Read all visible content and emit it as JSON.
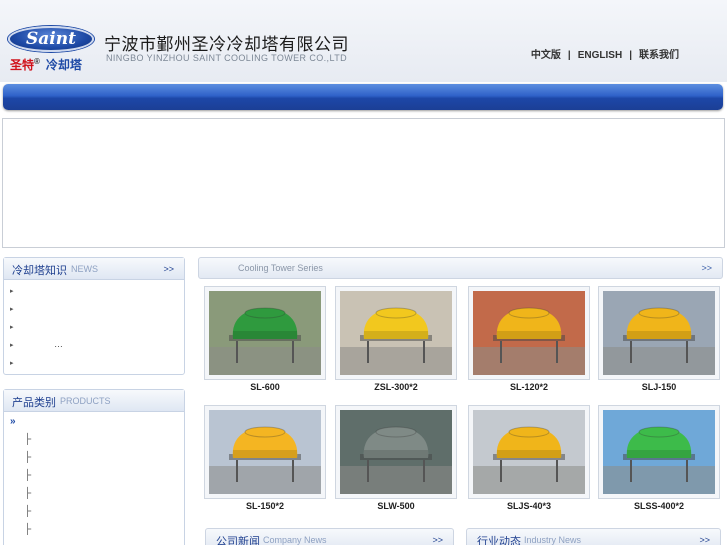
{
  "header": {
    "logo_text": "Saint",
    "logo_cn_red": "圣特",
    "logo_reg": "®",
    "logo_cn_blue": "冷却塔",
    "company_cn": "宁波市鄞州圣冷冷却塔有限公司",
    "company_en": "NINGBO YINZHOU SAINT COOLING  TOWER CO.,LTD",
    "nav": [
      {
        "label": "中文版"
      },
      {
        "label": "ENGLISH"
      },
      {
        "label": "联系我们"
      }
    ],
    "nav_separator": "|"
  },
  "news_box": {
    "title_cn": "冷却塔知识",
    "title_en": "NEWS",
    "more": ">>",
    "items": [
      {
        "bullet": "▸",
        "text": ""
      },
      {
        "bullet": "▸",
        "text": ""
      },
      {
        "bullet": "▸",
        "text": ""
      },
      {
        "bullet": "▸",
        "text": "…"
      },
      {
        "bullet": "▸",
        "text": ""
      }
    ]
  },
  "products_box": {
    "title_cn": "产品类别",
    "title_en": "PRODUCTS",
    "items": [
      {
        "label": "»",
        "kind": "top"
      },
      {
        "label": "├",
        "kind": "sub"
      },
      {
        "label": "├",
        "kind": "sub"
      },
      {
        "label": "├",
        "kind": "sub"
      },
      {
        "label": "├",
        "kind": "sub"
      },
      {
        "label": "├",
        "kind": "sub"
      },
      {
        "label": "├",
        "kind": "sub"
      }
    ]
  },
  "series": {
    "title": "Cooling Tower Series",
    "more": ">>",
    "products": [
      {
        "name": "SL-600",
        "tower_color": "#2f9a3e",
        "bg": "#8a9a7a"
      },
      {
        "name": "ZSL-300*2",
        "tower_color": "#f2c81e",
        "bg": "#c9c2b4"
      },
      {
        "name": "SL-120*2",
        "tower_color": "#f0b51a",
        "bg": "#c26a4a"
      },
      {
        "name": "SLJ-150",
        "tower_color": "#f0b51a",
        "bg": "#9aa6b4"
      },
      {
        "name": "SL-150*2",
        "tower_color": "#f4b522",
        "bg": "#b9c4d2"
      },
      {
        "name": "SLW-500",
        "tower_color": "#7f8a86",
        "bg": "#5f6e6a"
      },
      {
        "name": "SLJS-40*3",
        "tower_color": "#f0b51a",
        "bg": "#c4c9cf"
      },
      {
        "name": "SLSS-400*2",
        "tower_color": "#3dbb4a",
        "bg": "#6fa8d8"
      }
    ]
  },
  "bottom": {
    "company_news_cn": "公司新闻",
    "company_news_en": "Company News",
    "industry_news_cn": "行业动态",
    "industry_news_en": "Industry News",
    "more": ">>"
  }
}
